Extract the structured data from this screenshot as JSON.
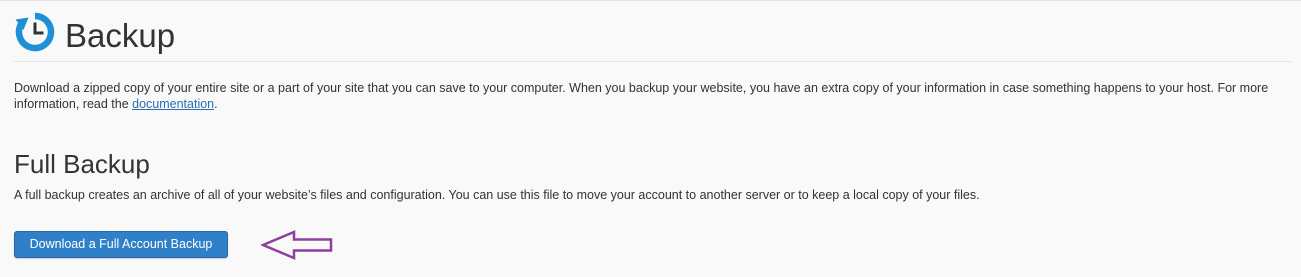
{
  "header": {
    "title": "Backup",
    "icon": "backup-clock-icon",
    "icon_color": "#1e90d6"
  },
  "intro": {
    "text_before_link": "Download a zipped copy of your entire site or a part of your site that you can save to your computer. When you backup your website, you have an extra copy of your information in case something happens to your host. For more information, read the ",
    "link_text": "documentation",
    "text_after_link": "."
  },
  "full_backup": {
    "title": "Full Backup",
    "description": "A full backup creates an archive of all of your website’s files and configuration. You can use this file to move your account to another server or to keep a local copy of your files.",
    "button_label": "Download a Full Account Backup",
    "button_color": "#2f80c9"
  },
  "annotation": {
    "icon": "arrow-left-annotation-icon",
    "color": "#8e3f9e"
  }
}
